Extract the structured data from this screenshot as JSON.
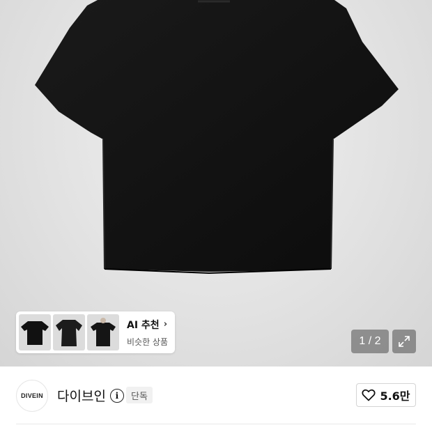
{
  "gallery": {
    "pager_text": "1 / 2",
    "image_icon": "tshirt-image",
    "expand_icon": "expand-icon"
  },
  "ai_recommend": {
    "title": "AI 추천",
    "subtitle": "비슷한 상품",
    "chevron": "›",
    "thumbnails": [
      "black-tshirt-front",
      "black-tshirt-flat",
      "black-tshirt-model"
    ]
  },
  "brand": {
    "logo_text": "DIVEIN",
    "name": "다이브인",
    "info_icon": "i",
    "tag": "단독"
  },
  "like": {
    "count": "5.6만",
    "icon": "heart-icon"
  }
}
